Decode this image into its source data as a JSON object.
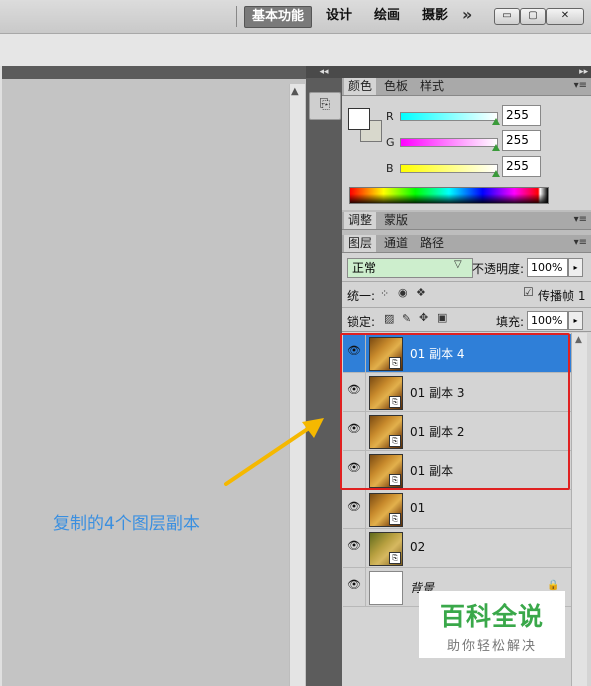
{
  "workspace": {
    "items": [
      "基本功能",
      "设计",
      "绘画",
      "摄影"
    ],
    "more": "»"
  },
  "window_buttons": {
    "min": "▭",
    "max": "▢",
    "close": "✕"
  },
  "color_panel": {
    "tabs": [
      "颜色",
      "色板",
      "样式"
    ],
    "labels": {
      "r": "R",
      "g": "G",
      "b": "B"
    },
    "values": {
      "r": "255",
      "g": "255",
      "b": "255"
    }
  },
  "adjust_panel": {
    "tabs": [
      "调整",
      "蒙版"
    ]
  },
  "layers_panel": {
    "tabs": [
      "图层",
      "通道",
      "路径"
    ],
    "blend_mode": "正常",
    "opacity_label": "不透明度:",
    "opacity_value": "100%",
    "unify_label": "统一:",
    "propagate_label": "传播帧 1",
    "lock_label": "锁定:",
    "fill_label": "填充:",
    "fill_value": "100%",
    "layers": [
      {
        "name": "01 副本 4",
        "selected": true,
        "smart": true
      },
      {
        "name": "01 副本 3",
        "selected": false,
        "smart": true
      },
      {
        "name": "01 副本 2",
        "selected": false,
        "smart": true
      },
      {
        "name": "01 副本",
        "selected": false,
        "smart": true
      },
      {
        "name": "01",
        "selected": false,
        "smart": true
      },
      {
        "name": "02",
        "selected": false,
        "smart": true
      },
      {
        "name": "背景",
        "selected": false,
        "smart": false
      }
    ]
  },
  "annotation": {
    "callout": "复制的4个图层副本"
  },
  "watermark": {
    "title": "百科全说",
    "subtitle": "助你轻松解决"
  },
  "colors": {
    "selected_row": "#2f7fd8",
    "highlight": "#e02020",
    "callout": "#3a8fe0",
    "arrow": "#f5b800"
  },
  "icons": [
    "eye-icon",
    "lock-icon",
    "smart-object-icon",
    "check-icon",
    "brush-icon",
    "move-icon"
  ]
}
